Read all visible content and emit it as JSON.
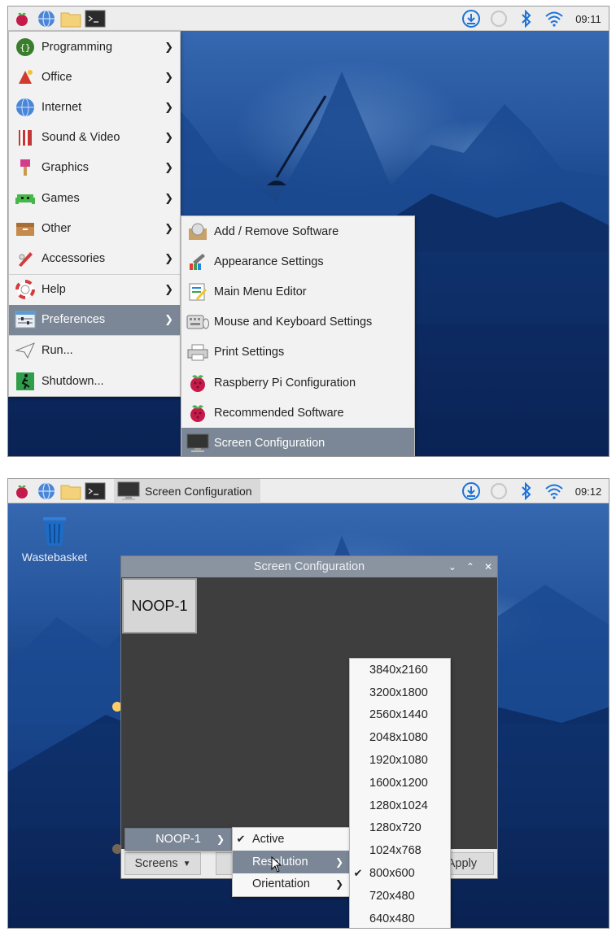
{
  "shot1": {
    "clock": "09:11",
    "main_menu": [
      {
        "label": "Programming",
        "icon": "programming-icon",
        "submenu": true
      },
      {
        "label": "Office",
        "icon": "office-icon",
        "submenu": true
      },
      {
        "label": "Internet",
        "icon": "internet-icon",
        "submenu": true
      },
      {
        "label": "Sound & Video",
        "icon": "sound-video-icon",
        "submenu": true
      },
      {
        "label": "Graphics",
        "icon": "graphics-icon",
        "submenu": true
      },
      {
        "label": "Games",
        "icon": "games-icon",
        "submenu": true
      },
      {
        "label": "Other",
        "icon": "other-icon",
        "submenu": true
      },
      {
        "label": "Accessories",
        "icon": "accessories-icon",
        "submenu": true
      },
      {
        "label": "Help",
        "icon": "help-icon",
        "submenu": true
      },
      {
        "label": "Preferences",
        "icon": "preferences-icon",
        "submenu": true,
        "selected": true
      },
      {
        "label": "Run...",
        "icon": "run-icon",
        "submenu": false
      },
      {
        "label": "Shutdown...",
        "icon": "shutdown-icon",
        "submenu": false
      }
    ],
    "preferences_submenu": [
      {
        "label": "Add / Remove Software",
        "icon": "add-remove-software-icon"
      },
      {
        "label": "Appearance Settings",
        "icon": "appearance-settings-icon"
      },
      {
        "label": "Main Menu Editor",
        "icon": "menu-editor-icon"
      },
      {
        "label": "Mouse and Keyboard Settings",
        "icon": "keyboard-mouse-icon"
      },
      {
        "label": "Print Settings",
        "icon": "printer-icon"
      },
      {
        "label": "Raspberry Pi Configuration",
        "icon": "raspberry-icon"
      },
      {
        "label": "Recommended Software",
        "icon": "raspberry-icon"
      },
      {
        "label": "Screen Configuration",
        "icon": "monitor-icon",
        "selected": true
      }
    ]
  },
  "shot2": {
    "clock": "09:12",
    "task_label": "Screen Configuration",
    "desktop_icon_label": "Wastebasket",
    "window": {
      "title": "Screen Configuration",
      "display_label": "NOOP-1",
      "screens_button": "Screens",
      "apply_button": "Apply"
    },
    "screens_menu": {
      "label": "NOOP-1"
    },
    "noop_submenu": [
      {
        "label": "Active",
        "checked": true
      },
      {
        "label": "Resolution",
        "submenu": true,
        "selected": true
      },
      {
        "label": "Orientation",
        "submenu": true
      }
    ],
    "resolutions": [
      {
        "label": "3840x2160",
        "checked": false
      },
      {
        "label": "3200x1800",
        "checked": false
      },
      {
        "label": "2560x1440",
        "checked": false
      },
      {
        "label": "2048x1080",
        "checked": false
      },
      {
        "label": "1920x1080",
        "checked": false
      },
      {
        "label": "1600x1200",
        "checked": false
      },
      {
        "label": "1280x1024",
        "checked": false
      },
      {
        "label": "1280x720",
        "checked": false
      },
      {
        "label": "1024x768",
        "checked": false
      },
      {
        "label": "800x600",
        "checked": true
      },
      {
        "label": "720x480",
        "checked": false
      },
      {
        "label": "640x480",
        "checked": false
      }
    ]
  },
  "colors": {
    "selection": "#7b8796",
    "taskbar": "#ededed",
    "accent_blue": "#1a73d9"
  }
}
